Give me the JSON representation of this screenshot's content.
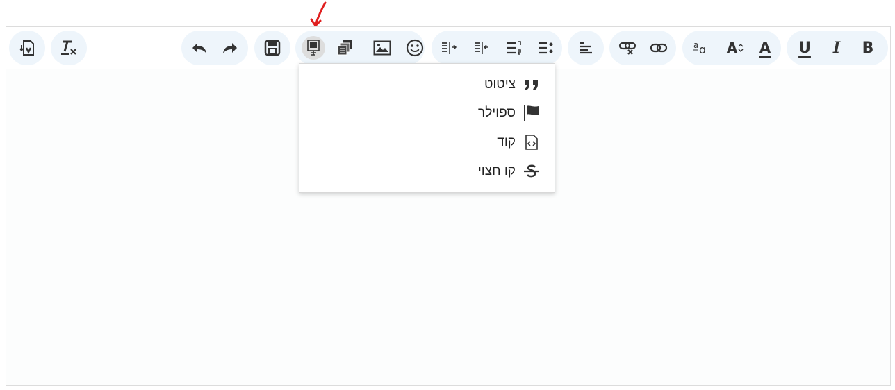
{
  "toolbar": {
    "groups": [
      "tools",
      "format-clear",
      "history",
      "insert",
      "align",
      "list",
      "links",
      "font",
      "style"
    ],
    "buttons": [
      {
        "icon": "paste-from-word-icon"
      },
      {
        "icon": "remove-format-icon"
      },
      {
        "icon": "undo-icon"
      },
      {
        "icon": "redo-icon"
      },
      {
        "icon": "save-icon"
      },
      {
        "icon": "block-format-icon"
      },
      {
        "icon": "copy-icon"
      },
      {
        "icon": "image-icon"
      },
      {
        "icon": "emoji-icon"
      },
      {
        "icon": "indent-icon"
      },
      {
        "icon": "outdent-icon"
      },
      {
        "icon": "numbered-list-icon"
      },
      {
        "icon": "bulleted-list-icon"
      },
      {
        "icon": "align-right-icon"
      },
      {
        "icon": "unlink-icon"
      },
      {
        "icon": "link-icon"
      },
      {
        "icon": "font-family-icon"
      },
      {
        "icon": "font-size-icon"
      },
      {
        "icon": "text-color-icon"
      },
      {
        "underline": "U",
        "italic": "I",
        "bold": "B"
      }
    ],
    "text_buttons": {
      "underline": "U",
      "italic": "I",
      "bold": "B",
      "font_size_label": "A",
      "font_color_label": "A"
    }
  },
  "dropdown": {
    "items": [
      {
        "label": "ציטוט",
        "icon": "quote-icon"
      },
      {
        "label": "ספוילר",
        "icon": "flag-icon"
      },
      {
        "label": "קוד",
        "icon": "code-file-icon"
      },
      {
        "label": "קו חצוי",
        "icon": "strikethrough-icon"
      }
    ]
  },
  "colors": {
    "annotation_arrow": "#e02020",
    "toolbar_group_bg": "#eef5fb",
    "active_button_bg": "#dddddd"
  }
}
